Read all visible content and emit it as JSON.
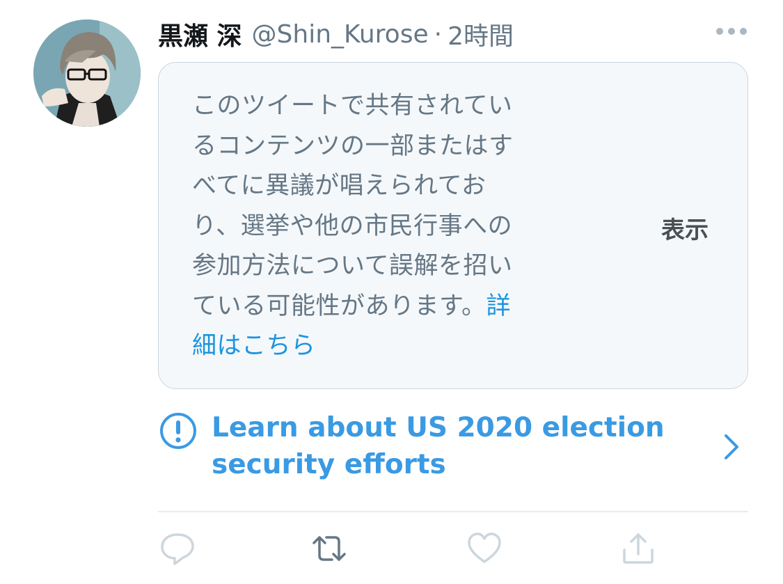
{
  "tweet": {
    "display_name": "黒瀬 深",
    "handle": "@Shin_Kurose",
    "separator": "·",
    "time": "2時間",
    "more_icon": "more-horizontal-icon"
  },
  "notice": {
    "lines": [
      "このツイートで共有されてい",
      "るコンテンツの一部またはす",
      "べてに異議が唱えられてお",
      "り、選挙や他の市民行事への",
      "参加方法について誤解を招い",
      "ている可能性があります。"
    ],
    "link_part1": "詳",
    "link_part2": "細はこちら",
    "show_label": "表示"
  },
  "election": {
    "line1": "Learn about US 2020 election",
    "line2": "security efforts",
    "icon": "exclamation-circle-icon",
    "chevron": "chevron-right-icon"
  },
  "actions": {
    "reply_icon": "reply-icon",
    "retweet_icon": "retweet-icon",
    "like_icon": "heart-icon",
    "share_icon": "share-icon"
  },
  "colors": {
    "link_blue": "#1b95e0",
    "election_blue": "#3a9ae3",
    "muted_gray": "#657786",
    "card_bg": "#f5f8fa",
    "icon_gray": "#aab8c2"
  }
}
